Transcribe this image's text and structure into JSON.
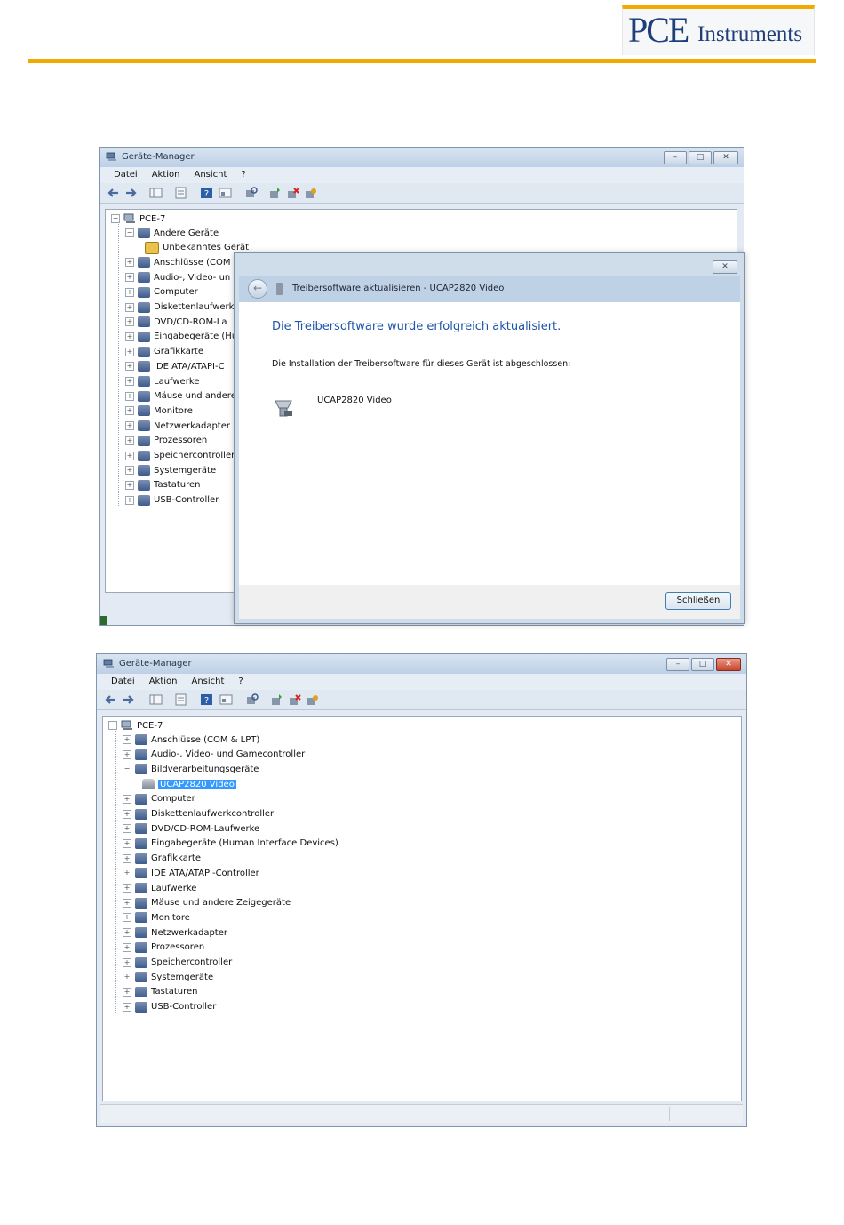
{
  "header": {
    "logo_letters": "PCE",
    "logo_word": "Instruments",
    "accent": "#f2a900"
  },
  "window1": {
    "title": "Geräte-Manager",
    "menu": [
      "Datei",
      "Aktion",
      "Ansicht",
      "?"
    ],
    "root": "PCE-7",
    "tree": [
      {
        "label": "Andere Geräte",
        "expanded": true
      },
      {
        "label": "Unbekanntes Gerät",
        "child": true
      },
      {
        "label": "Anschlüsse (COM"
      },
      {
        "label": "Audio-, Video- un"
      },
      {
        "label": "Computer"
      },
      {
        "label": "Diskettenlaufwerk"
      },
      {
        "label": "DVD/CD-ROM-La"
      },
      {
        "label": "Eingabegeräte (Hu"
      },
      {
        "label": "Grafikkarte"
      },
      {
        "label": "IDE ATA/ATAPI-C"
      },
      {
        "label": "Laufwerke"
      },
      {
        "label": "Mäuse und andere"
      },
      {
        "label": "Monitore"
      },
      {
        "label": "Netzwerkadapter"
      },
      {
        "label": "Prozessoren"
      },
      {
        "label": "Speichercontroller"
      },
      {
        "label": "Systemgeräte"
      },
      {
        "label": "Tastaturen"
      },
      {
        "label": "USB-Controller"
      }
    ]
  },
  "dialog": {
    "title": "Treibersoftware aktualisieren - UCAP2820 Video",
    "success": "Die Treibersoftware wurde erfolgreich aktualisiert.",
    "info": "Die Installation der Treibersoftware für dieses Gerät ist abgeschlossen:",
    "device": "UCAP2820 Video",
    "close_button": "Schließen",
    "close_glyph": "✕"
  },
  "window2": {
    "title": "Geräte-Manager",
    "menu": [
      "Datei",
      "Aktion",
      "Ansicht",
      "?"
    ],
    "root": "PCE-7",
    "tree": [
      {
        "label": "Anschlüsse (COM & LPT)"
      },
      {
        "label": "Audio-, Video- und Gamecontroller"
      },
      {
        "label": "Bildverarbeitungsgeräte",
        "expanded": true
      },
      {
        "label": "UCAP2820 Video",
        "child": true,
        "selected": true
      },
      {
        "label": "Computer"
      },
      {
        "label": "Diskettenlaufwerkcontroller"
      },
      {
        "label": "DVD/CD-ROM-Laufwerke"
      },
      {
        "label": "Eingabegeräte (Human Interface Devices)"
      },
      {
        "label": "Grafikkarte"
      },
      {
        "label": "IDE ATA/ATAPI-Controller"
      },
      {
        "label": "Laufwerke"
      },
      {
        "label": "Mäuse und andere Zeigegeräte"
      },
      {
        "label": "Monitore"
      },
      {
        "label": "Netzwerkadapter"
      },
      {
        "label": "Prozessoren"
      },
      {
        "label": "Speichercontroller"
      },
      {
        "label": "Systemgeräte"
      },
      {
        "label": "Tastaturen"
      },
      {
        "label": "USB-Controller"
      }
    ]
  },
  "caption_glyphs": {
    "minimize": "–",
    "maximize": "□",
    "close": "✕"
  }
}
